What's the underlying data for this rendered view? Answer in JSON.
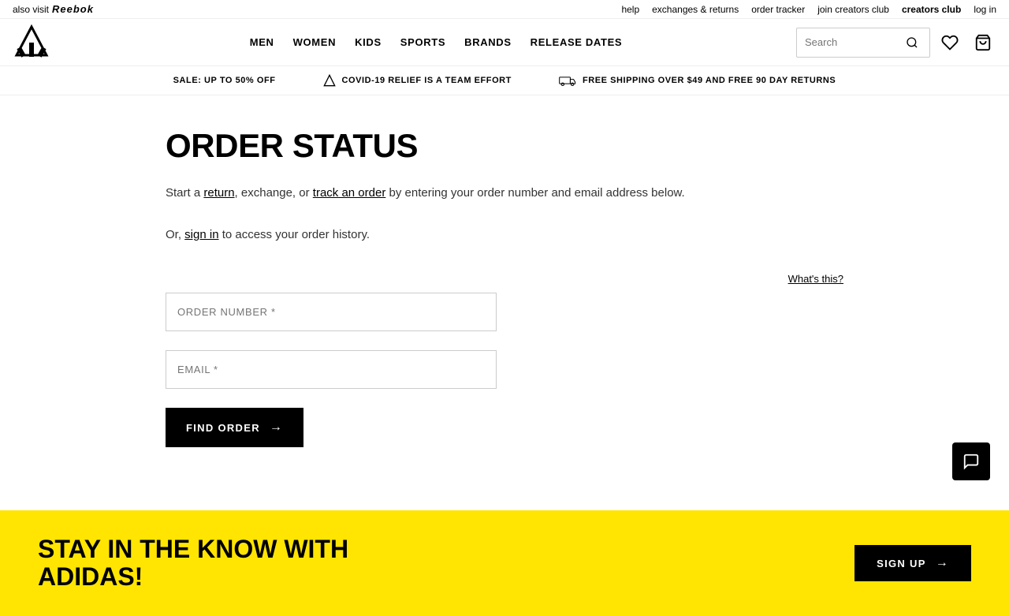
{
  "utility_bar": {
    "also_visit_label": "also visit",
    "reebok_label": "Reebok",
    "help_label": "help",
    "exchanges_returns_label": "exchanges & returns",
    "order_tracker_label": "order tracker",
    "join_creators_club_label": "join creators club",
    "creators_club_label": "creators club",
    "log_in_label": "log in"
  },
  "header": {
    "nav_items": [
      {
        "label": "MEN"
      },
      {
        "label": "WOMEN"
      },
      {
        "label": "KIDS"
      },
      {
        "label": "SPORTS"
      },
      {
        "label": "BRANDS"
      },
      {
        "label": "RELEASE DATES"
      }
    ],
    "search_placeholder": "Search"
  },
  "promo_bar": {
    "items": [
      {
        "text": "SALE: UP TO 50% OFF"
      },
      {
        "icon": "adidas-icon",
        "text": "COVID-19 RELIEF IS A TEAM EFFORT"
      },
      {
        "icon": "shipping-icon",
        "text": "FREE SHIPPING OVER $49 AND FREE 90 DAY RETURNS"
      }
    ]
  },
  "main": {
    "title": "ORDER STATUS",
    "description_part1": "Start a ",
    "return_link": "return",
    "description_part2": ", exchange, or ",
    "track_link": "track an order",
    "description_part3": " by entering your order number and email address below.",
    "sign_in_part1": "Or, ",
    "sign_in_link": "sign in",
    "sign_in_part2": " to access your order history.",
    "what_this_label": "What's this?",
    "order_number_placeholder": "ORDER NUMBER *",
    "email_placeholder": "EMAIL *",
    "find_order_button": "FIND ORDER"
  },
  "footer_promo": {
    "title_line1": "STAY IN THE KNOW WITH",
    "title_line2": "ADIDAS!",
    "sign_up_button": "SIGN UP"
  },
  "chat": {
    "icon": "chat-icon"
  }
}
